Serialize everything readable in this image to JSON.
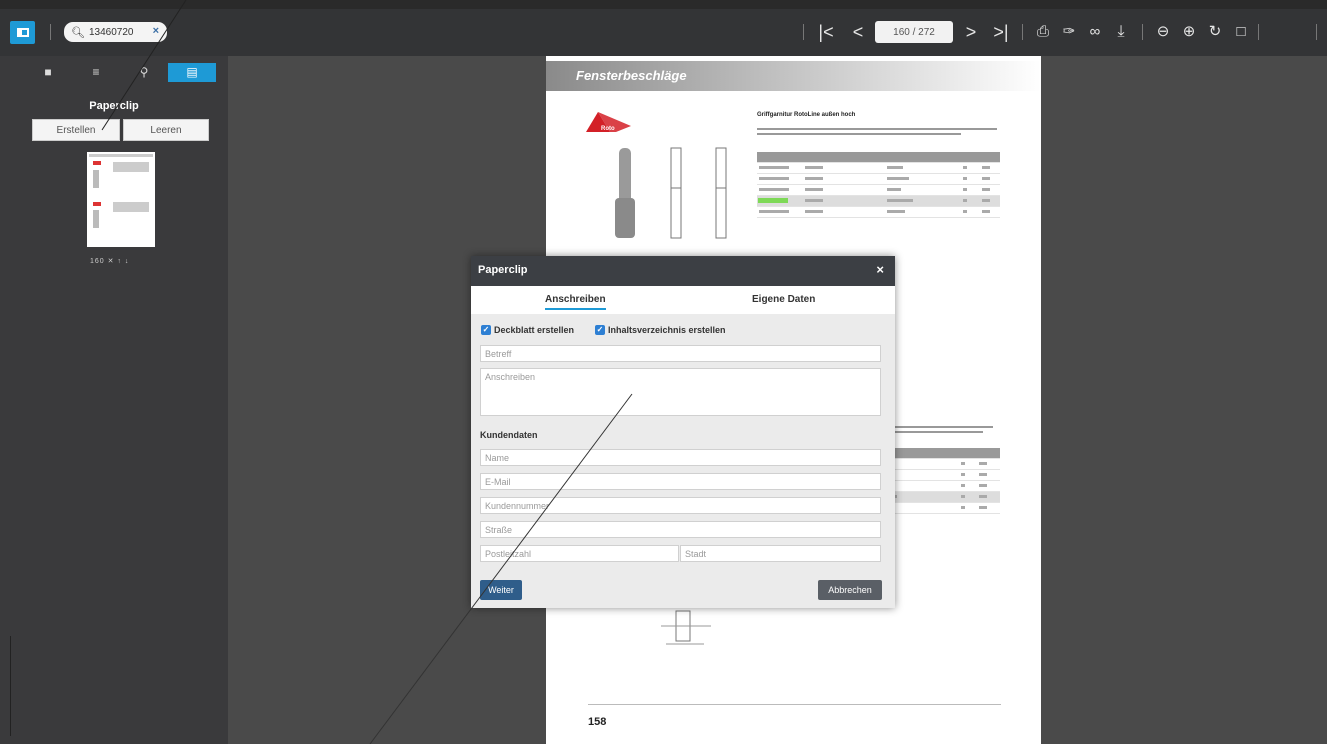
{
  "toolbar": {
    "search_value": "13460720",
    "page_indicator": "160 / 272",
    "icons": [
      "first-page-icon",
      "prev-page-icon",
      "next-page-icon",
      "last-page-icon",
      "print-icon",
      "attachment-icon",
      "link-icon",
      "download-icon",
      "zoom-out-icon",
      "zoom-in-icon",
      "rotate-icon",
      "document-icon"
    ]
  },
  "sidebar": {
    "title": "Paperclip",
    "create_button": "Erstellen",
    "clear_button": "Leeren",
    "thumb_label": "160 ✕ ↑ ↓"
  },
  "page": {
    "header_title": "Fensterbeschläge",
    "logo_text": "Roto",
    "product_title": "Griffgarnitur RotoLine außen hoch",
    "page_number": "158"
  },
  "modal": {
    "title": "Paperclip",
    "close": "×",
    "tabs": [
      "Anschreiben",
      "Eigene Daten"
    ],
    "checkbox_cover": "Deckblatt erstellen",
    "checkbox_toc": "Inhaltsverzeichnis erstellen",
    "subject_placeholder": "Betreff",
    "letter_placeholder": "Anschreiben",
    "customer_section": "Kundendaten",
    "name_placeholder": "Name",
    "email_placeholder": "E-Mail",
    "customer_no_placeholder": "Kundennummer",
    "street_placeholder": "Straße",
    "zip_placeholder": "Postleitzahl",
    "city_placeholder": "Stadt",
    "next_button": "Weiter",
    "cancel_button": "Abbrechen"
  },
  "colors": {
    "accent": "#1e9ad6",
    "toolbar_bg": "#333436",
    "sidebar_bg": "#3a3a3c",
    "workspace_bg": "#4a4a4a",
    "modal_header": "#3c3f44",
    "next_button": "#2f5d8a"
  }
}
